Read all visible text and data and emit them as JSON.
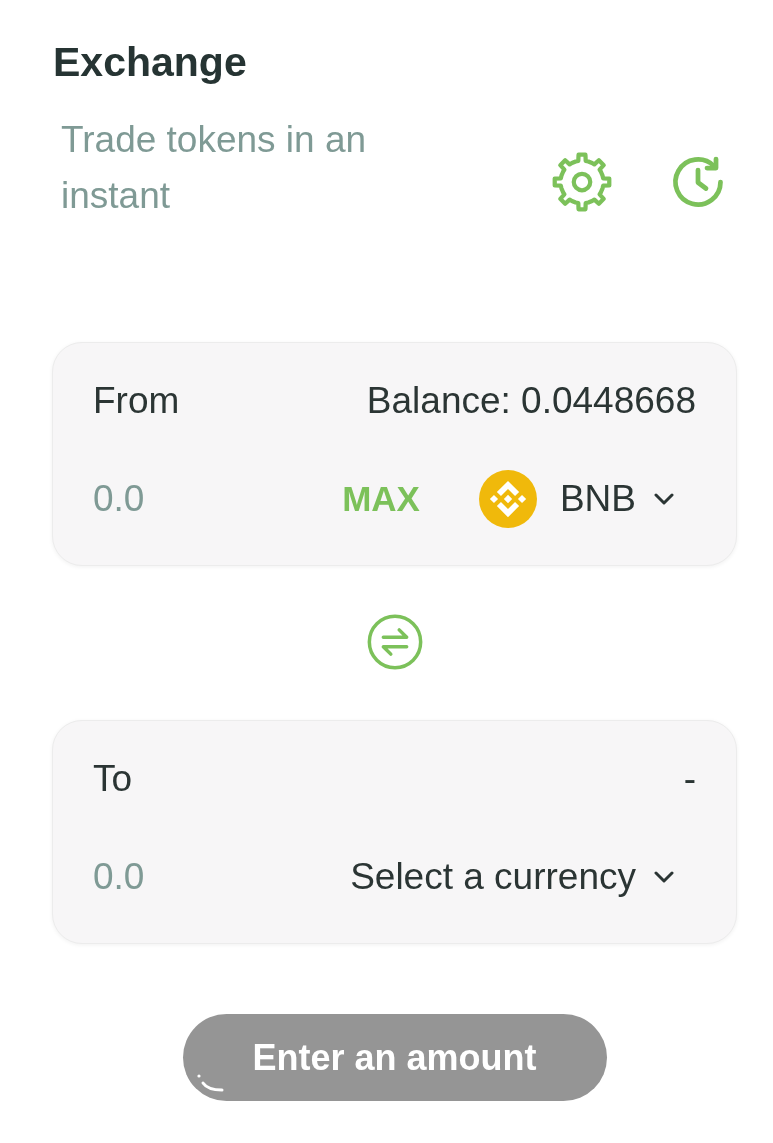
{
  "header": {
    "title": "Exchange",
    "subtitle": "Trade tokens in an instant"
  },
  "panels": [
    {
      "label": "From",
      "balance": "Balance: 0.0448668",
      "placeholder": "0.0",
      "max_button": "MAX",
      "currency": {
        "kind": "token",
        "label": "BNB"
      }
    },
    {
      "label": "To",
      "balance": "-",
      "placeholder": "0.0",
      "currency": {
        "kind": "select",
        "label": "Select a currency"
      }
    }
  ],
  "submit": {
    "label": "Enter an amount",
    "disabled": true,
    "loading": true
  }
}
